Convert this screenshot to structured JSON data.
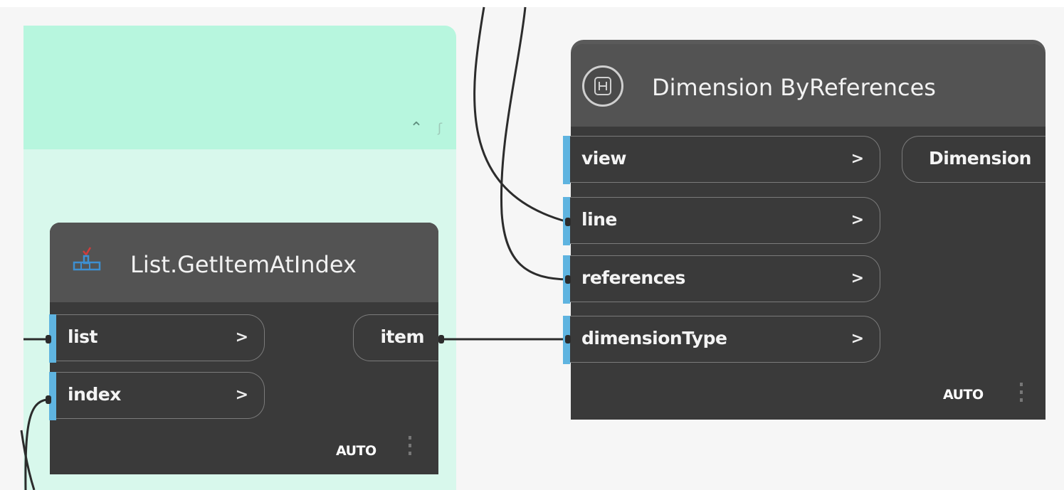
{
  "nodes": {
    "get_item": {
      "title": "List.GetItemAtIndex",
      "inputs": [
        {
          "label": "list",
          "arrow": ">"
        },
        {
          "label": "index",
          "arrow": ">"
        }
      ],
      "output": "item",
      "lacing": "AUTO",
      "icon": "list-get-item-icon"
    },
    "dimension": {
      "title": "Dimension ByReferences",
      "inputs": [
        {
          "label": "view",
          "arrow": ">"
        },
        {
          "label": "line",
          "arrow": ">"
        },
        {
          "label": "references",
          "arrow": ">"
        },
        {
          "label": "dimensionType",
          "arrow": ">"
        }
      ],
      "output": "Dimension",
      "lacing": "AUTO",
      "icon": "dimension-icon"
    }
  },
  "group": {
    "collapse_icon": "chevron-up-icon",
    "color": "#b7f6de"
  },
  "colors": {
    "node_body": "#3a3a3a",
    "node_header": "#535353",
    "port_accent": "#5fb4e0",
    "wire": "#2c2c2c"
  }
}
